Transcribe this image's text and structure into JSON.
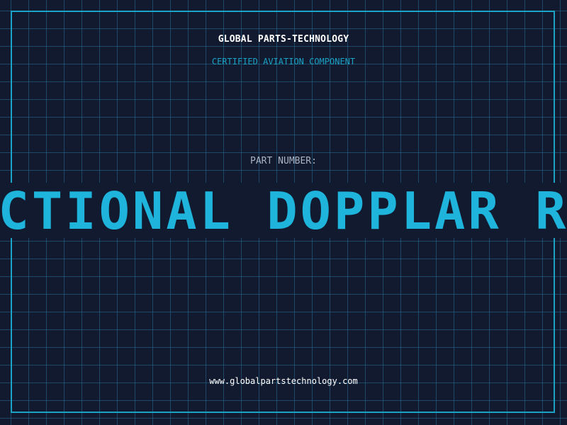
{
  "header": {
    "company": "GLOBAL PARTS-TECHNOLOGY",
    "subtitle": "CERTIFIED AVIATION COMPONENT"
  },
  "part": {
    "label": "PART NUMBER:",
    "value": "DIRECTIONAL DOPPLAR RADAR"
  },
  "footer": {
    "url": "www.globalpartstechnology.com"
  },
  "colors": {
    "background": "#121a2f",
    "grid": "#286e96",
    "accent": "#1ba3c6",
    "part_value": "#1eb4dc",
    "text": "#ffffff",
    "muted_text": "#aab4c3"
  }
}
